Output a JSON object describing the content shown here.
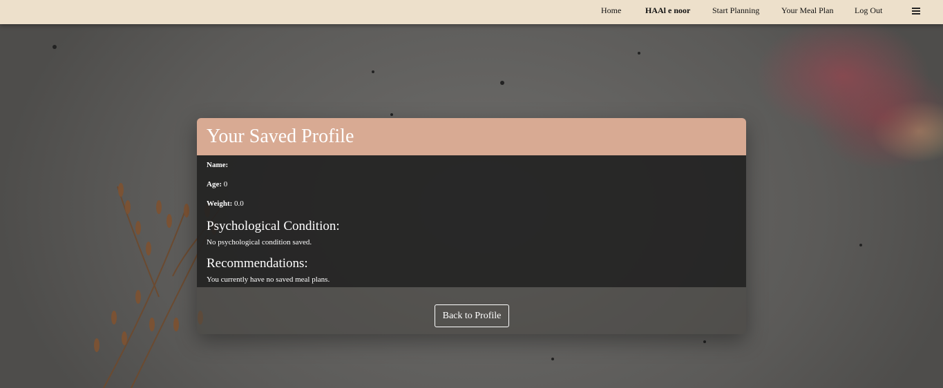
{
  "nav": {
    "links": [
      {
        "label": "Home"
      },
      {
        "label": "HAAl e noor"
      },
      {
        "label": "Start Planning"
      },
      {
        "label": "Your Meal Plan"
      },
      {
        "label": "Log Out"
      }
    ],
    "menu_icon": "hamburger-menu-icon"
  },
  "profile": {
    "title": "Your Saved Profile",
    "name_label": "Name:",
    "name_value": "",
    "age_label": "Age:",
    "age_value": "0",
    "weight_label": "Weight:",
    "weight_value": "0.0",
    "psych_heading": "Psychological Condition:",
    "psych_text": "No psychological condition saved.",
    "rec_heading": "Recommendations:",
    "rec_text": "You currently have no saved meal plans.",
    "back_button": "Back to Profile"
  },
  "colors": {
    "navbar_bg": "#ede0cb",
    "header_bg": "#d8aa93"
  }
}
